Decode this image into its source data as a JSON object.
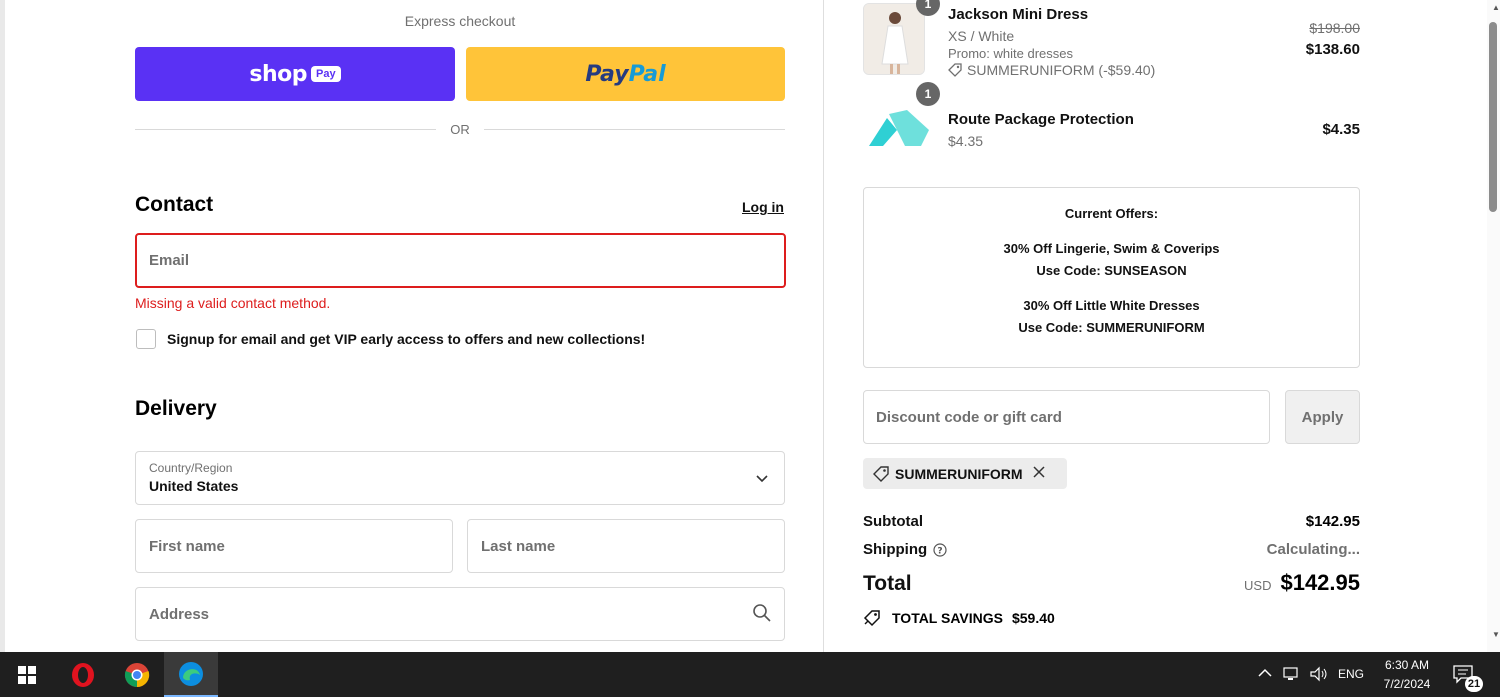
{
  "checkout": {
    "express_title": "Express checkout",
    "shop_pay": {
      "shop": "shop",
      "pay": "Pay"
    },
    "paypal": {
      "part1": "Pay",
      "part2": "Pal"
    },
    "or": "OR",
    "contact": {
      "heading": "Contact",
      "login": "Log in",
      "email_placeholder": "Email",
      "error": "Missing a valid contact method.",
      "signup_label": "Signup for email and get VIP early access to offers and new collections!"
    },
    "delivery": {
      "heading": "Delivery",
      "country_label": "Country/Region",
      "country_value": "United States",
      "first_name_placeholder": "First name",
      "last_name_placeholder": "Last name",
      "address_placeholder": "Address"
    }
  },
  "summary": {
    "items": [
      {
        "qty": "1",
        "name": "Jackson Mini Dress",
        "variant": "XS / White",
        "promo": "Promo: white dresses",
        "discount_tag": "SUMMERUNIFORM (-$59.40)",
        "original_price": "$198.00",
        "price": "$138.60"
      },
      {
        "qty": "1",
        "name": "Route Package Protection",
        "variant": "$4.35",
        "price": "$4.35"
      }
    ],
    "offers": {
      "title": "Current Offers:",
      "offer1_line1": "30% Off Lingerie, Swim & Coverips",
      "offer1_line2": "Use Code: SUNSEASON",
      "offer2_line1": "30% Off Little White Dresses",
      "offer2_line2": "Use Code: SUMMERUNIFORM"
    },
    "discount_placeholder": "Discount code or gift card",
    "apply": "Apply",
    "applied_code": "SUMMERUNIFORM",
    "subtotal_label": "Subtotal",
    "subtotal_value": "$142.95",
    "shipping_label": "Shipping",
    "shipping_value": "Calculating...",
    "total_label": "Total",
    "total_currency": "USD",
    "total_value": "$142.95",
    "savings_label": "TOTAL SAVINGS",
    "savings_value": "$59.40"
  },
  "taskbar": {
    "lang": "ENG",
    "time": "6:30 AM",
    "date": "7/2/2024",
    "notification_count": "21"
  },
  "colors": {
    "shop_pay": "#5a31f4",
    "paypal": "#ffc439",
    "error": "#dd1d1d"
  }
}
